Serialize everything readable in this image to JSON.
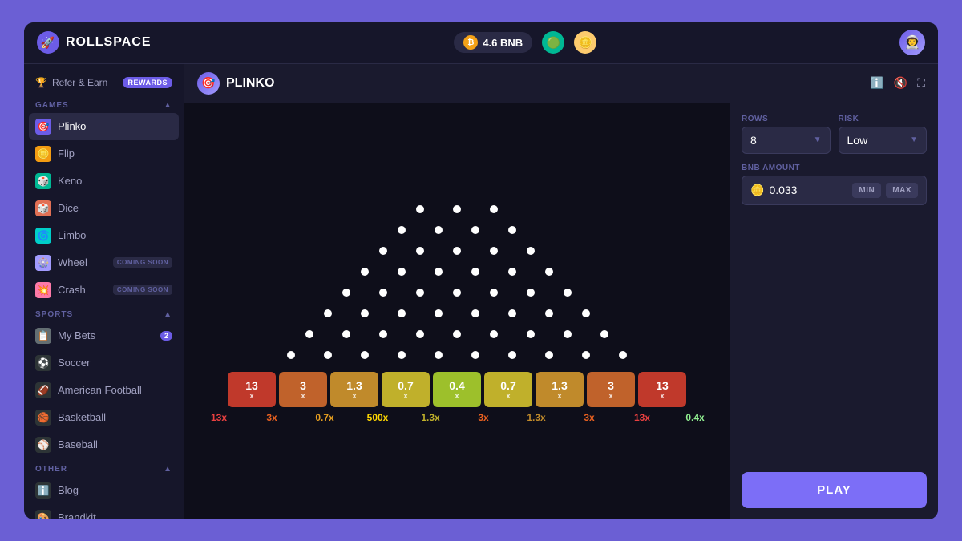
{
  "app": {
    "name": "ROLLSPACE",
    "balance": "4.6 BNB"
  },
  "header": {
    "title": "ROLLSPACE",
    "balance_label": "4.6 BNB",
    "info_icon": "ℹ",
    "sound_icon": "🔇",
    "fullscreen_icon": "⛶"
  },
  "sidebar": {
    "refer_label": "Refer & Earn",
    "rewards_badge": "REWARDS",
    "sections": [
      {
        "id": "games",
        "label": "GAMES",
        "items": [
          {
            "id": "plinko",
            "label": "Plinko",
            "icon": "🎯",
            "active": true,
            "badge": null,
            "coming_soon": false
          },
          {
            "id": "flip",
            "label": "Flip",
            "icon": "🪙",
            "active": false,
            "badge": null,
            "coming_soon": false
          },
          {
            "id": "keno",
            "label": "Keno",
            "icon": "🎲",
            "active": false,
            "badge": null,
            "coming_soon": false
          },
          {
            "id": "dice",
            "label": "Dice",
            "icon": "🎲",
            "active": false,
            "badge": null,
            "coming_soon": false
          },
          {
            "id": "limbo",
            "label": "Limbo",
            "icon": "🌀",
            "active": false,
            "badge": null,
            "coming_soon": false
          },
          {
            "id": "wheel",
            "label": "Wheel",
            "icon": "🎡",
            "active": false,
            "badge": null,
            "coming_soon": true
          },
          {
            "id": "crash",
            "label": "Crash",
            "icon": "💥",
            "active": false,
            "badge": null,
            "coming_soon": true
          }
        ]
      },
      {
        "id": "sports",
        "label": "SPORTS",
        "items": [
          {
            "id": "my-bets",
            "label": "My Bets",
            "icon": "📋",
            "active": false,
            "badge": "2",
            "coming_soon": false
          },
          {
            "id": "soccer",
            "label": "Soccer",
            "icon": "⚽",
            "active": false,
            "badge": null,
            "coming_soon": false
          },
          {
            "id": "american-football",
            "label": "American Football",
            "icon": "🏈",
            "active": false,
            "badge": null,
            "coming_soon": false
          },
          {
            "id": "basketball",
            "label": "Basketball",
            "icon": "🏀",
            "active": false,
            "badge": null,
            "coming_soon": false
          },
          {
            "id": "baseball",
            "label": "Baseball",
            "icon": "⚾",
            "active": false,
            "badge": null,
            "coming_soon": false
          }
        ]
      },
      {
        "id": "other",
        "label": "OTHER",
        "items": [
          {
            "id": "blog",
            "label": "Blog",
            "icon": "📰",
            "active": false,
            "badge": null,
            "coming_soon": false
          },
          {
            "id": "brandkit",
            "label": "Brandkit",
            "icon": "🎨",
            "active": false,
            "badge": null,
            "coming_soon": false
          }
        ]
      }
    ]
  },
  "game": {
    "title": "PLINKO",
    "rows_label": "ROWS",
    "rows_value": "8",
    "risk_label": "RISK",
    "risk_value": "Low",
    "bnb_amount_label": "BNB AMOUNT",
    "bnb_amount_value": "0.033",
    "min_label": "MIN",
    "max_label": "MAX",
    "play_label": "PLAY",
    "multipliers": [
      {
        "value": "13",
        "x": "x",
        "color": "#e84040",
        "text_color": "#ff6b6b"
      },
      {
        "value": "3",
        "x": "x",
        "color": "#e86020",
        "text_color": "#ff8c42"
      },
      {
        "value": "1.3",
        "x": "x",
        "color": "#e8a020",
        "text_color": "#ffb347"
      },
      {
        "value": "0.7",
        "x": "x",
        "color": "#e8d020",
        "text_color": "#ffd700"
      },
      {
        "value": "0.4",
        "x": "x",
        "color": "#d4e820",
        "text_color": "#c8ff32"
      },
      {
        "value": "0.7",
        "x": "x",
        "color": "#e8d020",
        "text_color": "#ffd700"
      },
      {
        "value": "1.3",
        "x": "x",
        "color": "#e8a020",
        "text_color": "#ffb347"
      },
      {
        "value": "3",
        "x": "x",
        "color": "#e86020",
        "text_color": "#ff8c42"
      },
      {
        "value": "13",
        "x": "x",
        "color": "#e84040",
        "text_color": "#ff6b6b"
      }
    ],
    "bottom_multipliers": [
      {
        "value": "13x",
        "color": "#e84040"
      },
      {
        "value": "3x",
        "color": "#e86020"
      },
      {
        "value": "0.7x",
        "color": "#e8a020"
      },
      {
        "value": "500x",
        "color": "#ffd700"
      },
      {
        "value": "1.3x",
        "color": "#e8a020"
      },
      {
        "value": "3x",
        "color": "#e86020"
      },
      {
        "value": "1.3x",
        "color": "#e8a020"
      },
      {
        "value": "3x",
        "color": "#e86020"
      },
      {
        "value": "13x",
        "color": "#e84040"
      },
      {
        "value": "0.4x",
        "color": "#90ee90"
      }
    ],
    "peg_rows": [
      3,
      4,
      5,
      6,
      7,
      8,
      9,
      10
    ]
  }
}
